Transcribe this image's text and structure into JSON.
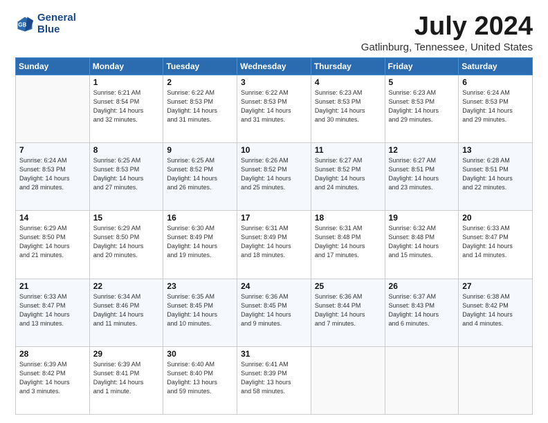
{
  "header": {
    "logo_line1": "General",
    "logo_line2": "Blue",
    "title": "July 2024",
    "subtitle": "Gatlinburg, Tennessee, United States"
  },
  "weekdays": [
    "Sunday",
    "Monday",
    "Tuesday",
    "Wednesday",
    "Thursday",
    "Friday",
    "Saturday"
  ],
  "weeks": [
    [
      {
        "day": "",
        "info": ""
      },
      {
        "day": "1",
        "info": "Sunrise: 6:21 AM\nSunset: 8:54 PM\nDaylight: 14 hours\nand 32 minutes."
      },
      {
        "day": "2",
        "info": "Sunrise: 6:22 AM\nSunset: 8:53 PM\nDaylight: 14 hours\nand 31 minutes."
      },
      {
        "day": "3",
        "info": "Sunrise: 6:22 AM\nSunset: 8:53 PM\nDaylight: 14 hours\nand 31 minutes."
      },
      {
        "day": "4",
        "info": "Sunrise: 6:23 AM\nSunset: 8:53 PM\nDaylight: 14 hours\nand 30 minutes."
      },
      {
        "day": "5",
        "info": "Sunrise: 6:23 AM\nSunset: 8:53 PM\nDaylight: 14 hours\nand 29 minutes."
      },
      {
        "day": "6",
        "info": "Sunrise: 6:24 AM\nSunset: 8:53 PM\nDaylight: 14 hours\nand 29 minutes."
      }
    ],
    [
      {
        "day": "7",
        "info": "Sunrise: 6:24 AM\nSunset: 8:53 PM\nDaylight: 14 hours\nand 28 minutes."
      },
      {
        "day": "8",
        "info": "Sunrise: 6:25 AM\nSunset: 8:53 PM\nDaylight: 14 hours\nand 27 minutes."
      },
      {
        "day": "9",
        "info": "Sunrise: 6:25 AM\nSunset: 8:52 PM\nDaylight: 14 hours\nand 26 minutes."
      },
      {
        "day": "10",
        "info": "Sunrise: 6:26 AM\nSunset: 8:52 PM\nDaylight: 14 hours\nand 25 minutes."
      },
      {
        "day": "11",
        "info": "Sunrise: 6:27 AM\nSunset: 8:52 PM\nDaylight: 14 hours\nand 24 minutes."
      },
      {
        "day": "12",
        "info": "Sunrise: 6:27 AM\nSunset: 8:51 PM\nDaylight: 14 hours\nand 23 minutes."
      },
      {
        "day": "13",
        "info": "Sunrise: 6:28 AM\nSunset: 8:51 PM\nDaylight: 14 hours\nand 22 minutes."
      }
    ],
    [
      {
        "day": "14",
        "info": "Sunrise: 6:29 AM\nSunset: 8:50 PM\nDaylight: 14 hours\nand 21 minutes."
      },
      {
        "day": "15",
        "info": "Sunrise: 6:29 AM\nSunset: 8:50 PM\nDaylight: 14 hours\nand 20 minutes."
      },
      {
        "day": "16",
        "info": "Sunrise: 6:30 AM\nSunset: 8:49 PM\nDaylight: 14 hours\nand 19 minutes."
      },
      {
        "day": "17",
        "info": "Sunrise: 6:31 AM\nSunset: 8:49 PM\nDaylight: 14 hours\nand 18 minutes."
      },
      {
        "day": "18",
        "info": "Sunrise: 6:31 AM\nSunset: 8:48 PM\nDaylight: 14 hours\nand 17 minutes."
      },
      {
        "day": "19",
        "info": "Sunrise: 6:32 AM\nSunset: 8:48 PM\nDaylight: 14 hours\nand 15 minutes."
      },
      {
        "day": "20",
        "info": "Sunrise: 6:33 AM\nSunset: 8:47 PM\nDaylight: 14 hours\nand 14 minutes."
      }
    ],
    [
      {
        "day": "21",
        "info": "Sunrise: 6:33 AM\nSunset: 8:47 PM\nDaylight: 14 hours\nand 13 minutes."
      },
      {
        "day": "22",
        "info": "Sunrise: 6:34 AM\nSunset: 8:46 PM\nDaylight: 14 hours\nand 11 minutes."
      },
      {
        "day": "23",
        "info": "Sunrise: 6:35 AM\nSunset: 8:45 PM\nDaylight: 14 hours\nand 10 minutes."
      },
      {
        "day": "24",
        "info": "Sunrise: 6:36 AM\nSunset: 8:45 PM\nDaylight: 14 hours\nand 9 minutes."
      },
      {
        "day": "25",
        "info": "Sunrise: 6:36 AM\nSunset: 8:44 PM\nDaylight: 14 hours\nand 7 minutes."
      },
      {
        "day": "26",
        "info": "Sunrise: 6:37 AM\nSunset: 8:43 PM\nDaylight: 14 hours\nand 6 minutes."
      },
      {
        "day": "27",
        "info": "Sunrise: 6:38 AM\nSunset: 8:42 PM\nDaylight: 14 hours\nand 4 minutes."
      }
    ],
    [
      {
        "day": "28",
        "info": "Sunrise: 6:39 AM\nSunset: 8:42 PM\nDaylight: 14 hours\nand 3 minutes."
      },
      {
        "day": "29",
        "info": "Sunrise: 6:39 AM\nSunset: 8:41 PM\nDaylight: 14 hours\nand 1 minute."
      },
      {
        "day": "30",
        "info": "Sunrise: 6:40 AM\nSunset: 8:40 PM\nDaylight: 13 hours\nand 59 minutes."
      },
      {
        "day": "31",
        "info": "Sunrise: 6:41 AM\nSunset: 8:39 PM\nDaylight: 13 hours\nand 58 minutes."
      },
      {
        "day": "",
        "info": ""
      },
      {
        "day": "",
        "info": ""
      },
      {
        "day": "",
        "info": ""
      }
    ]
  ]
}
